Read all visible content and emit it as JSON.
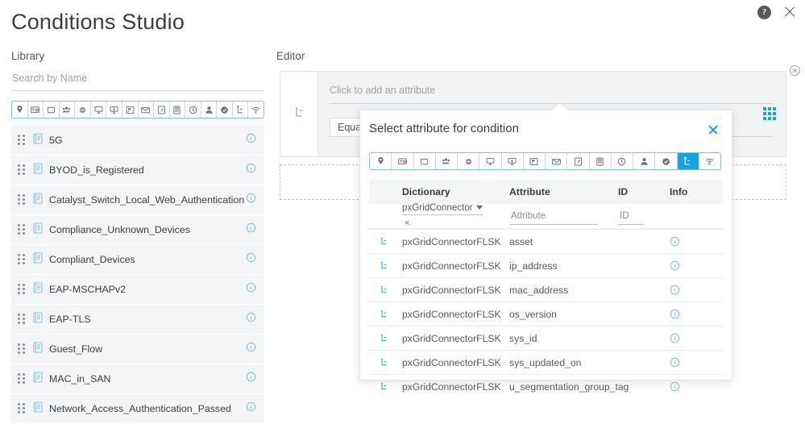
{
  "window": {
    "help_label": "?",
    "help_icon": "help-circle-icon",
    "close_icon": "close-icon"
  },
  "page_title": "Conditions Studio",
  "library": {
    "heading": "Library",
    "search": {
      "placeholder": "Search by Name",
      "value": ""
    },
    "filter_icons": [
      {
        "name": "location-pin-icon",
        "selected": false
      },
      {
        "name": "network-device-icon",
        "selected": false
      },
      {
        "name": "square-outline-icon",
        "selected": false
      },
      {
        "name": "group-users-icon",
        "selected": false
      },
      {
        "name": "circle-filled-icon",
        "selected": false
      },
      {
        "name": "desktop-icon",
        "selected": false
      },
      {
        "name": "monitor-download-icon",
        "selected": false
      },
      {
        "name": "policy-flag-icon",
        "selected": false
      },
      {
        "name": "envelope-icon",
        "selected": false
      },
      {
        "name": "certificate-icon",
        "selected": false
      },
      {
        "name": "server-rack-icon",
        "selected": false
      },
      {
        "name": "clock-icon",
        "selected": false
      },
      {
        "name": "user-profile-icon",
        "selected": false
      },
      {
        "name": "check-circle-icon",
        "selected": false
      },
      {
        "name": "pxgrid-connector-icon",
        "selected": false
      },
      {
        "name": "wifi-icon",
        "selected": false
      }
    ],
    "items": [
      {
        "label": "5G",
        "icon": "document-icon",
        "info_icon": "info-circle-icon"
      },
      {
        "label": "BYOD_is_Registered",
        "icon": "document-icon",
        "info_icon": "info-circle-icon"
      },
      {
        "label": "Catalyst_Switch_Local_Web_Authentication",
        "icon": "document-icon",
        "info_icon": "info-circle-icon"
      },
      {
        "label": "Compliance_Unknown_Devices",
        "icon": "document-icon",
        "info_icon": "info-circle-icon"
      },
      {
        "label": "Compliant_Devices",
        "icon": "document-icon",
        "info_icon": "info-circle-icon"
      },
      {
        "label": "EAP-MSCHAPv2",
        "icon": "document-icon",
        "info_icon": "info-circle-icon"
      },
      {
        "label": "EAP-TLS",
        "icon": "document-icon",
        "info_icon": "info-circle-icon"
      },
      {
        "label": "Guest_Flow",
        "icon": "document-icon",
        "info_icon": "info-circle-icon"
      },
      {
        "label": "MAC_in_SAN",
        "icon": "document-icon",
        "info_icon": "info-circle-icon"
      },
      {
        "label": "Network_Access_Authentication_Passed",
        "icon": "document-icon",
        "info_icon": "info-circle-icon"
      }
    ]
  },
  "editor": {
    "heading": "Editor",
    "condition_card": {
      "gutter_icon": "pxgrid-connector-icon",
      "attribute_placeholder": "Click to add an attribute",
      "operator": "Equals",
      "value": "",
      "grid_icon": "grid-dots-icon",
      "remove_icon": "remove-circle-icon"
    },
    "drop_zone_label": ""
  },
  "popover": {
    "title": "Select attribute for condition",
    "close_icon": "close-icon",
    "filter_icons": [
      {
        "name": "location-pin-icon",
        "selected": false
      },
      {
        "name": "network-device-icon",
        "selected": false
      },
      {
        "name": "square-outline-icon",
        "selected": false
      },
      {
        "name": "group-users-icon",
        "selected": false
      },
      {
        "name": "circle-filled-icon",
        "selected": false
      },
      {
        "name": "desktop-icon",
        "selected": false
      },
      {
        "name": "monitor-download-icon",
        "selected": false
      },
      {
        "name": "policy-flag-icon",
        "selected": false
      },
      {
        "name": "envelope-icon",
        "selected": false
      },
      {
        "name": "certificate-icon",
        "selected": false
      },
      {
        "name": "server-rack-icon",
        "selected": false
      },
      {
        "name": "clock-icon",
        "selected": false
      },
      {
        "name": "user-profile-icon",
        "selected": false
      },
      {
        "name": "check-circle-icon",
        "selected": false
      },
      {
        "name": "pxgrid-connector-icon",
        "selected": true
      },
      {
        "name": "wifi-icon",
        "selected": false
      }
    ],
    "table": {
      "columns": [
        "Dictionary",
        "Attribute",
        "ID",
        "Info"
      ],
      "filters": {
        "dictionary_value": "pxGridConnectorF...",
        "dictionary_clear": "×",
        "attribute_placeholder": "Attribute",
        "attribute_value": "",
        "id_placeholder": "ID",
        "id_value": ""
      },
      "rows": [
        {
          "icon": "pxgrid-connector-icon",
          "dictionary": "pxGridConnectorFLSK",
          "attribute": "asset",
          "id": "",
          "info_icon": "info-circle-icon"
        },
        {
          "icon": "pxgrid-connector-icon",
          "dictionary": "pxGridConnectorFLSK",
          "attribute": "ip_address",
          "id": "",
          "info_icon": "info-circle-icon"
        },
        {
          "icon": "pxgrid-connector-icon",
          "dictionary": "pxGridConnectorFLSK",
          "attribute": "mac_address",
          "id": "",
          "info_icon": "info-circle-icon"
        },
        {
          "icon": "pxgrid-connector-icon",
          "dictionary": "pxGridConnectorFLSK",
          "attribute": "os_version",
          "id": "",
          "info_icon": "info-circle-icon"
        },
        {
          "icon": "pxgrid-connector-icon",
          "dictionary": "pxGridConnectorFLSK",
          "attribute": "sys_id",
          "id": "",
          "info_icon": "info-circle-icon"
        },
        {
          "icon": "pxgrid-connector-icon",
          "dictionary": "pxGridConnectorFLSK",
          "attribute": "sys_updated_on",
          "id": "",
          "info_icon": "info-circle-icon"
        },
        {
          "icon": "pxgrid-connector-icon",
          "dictionary": "pxGridConnectorFLSK",
          "attribute": "u_segmentation_group_tag",
          "id": "",
          "info_icon": "info-circle-icon"
        }
      ]
    }
  },
  "colors": {
    "accent": "#15a3dd",
    "icon_outline": "#7fc3e3",
    "row_bg": "#f4f5f6",
    "text": "#58585b",
    "title": "#3c3c41"
  }
}
